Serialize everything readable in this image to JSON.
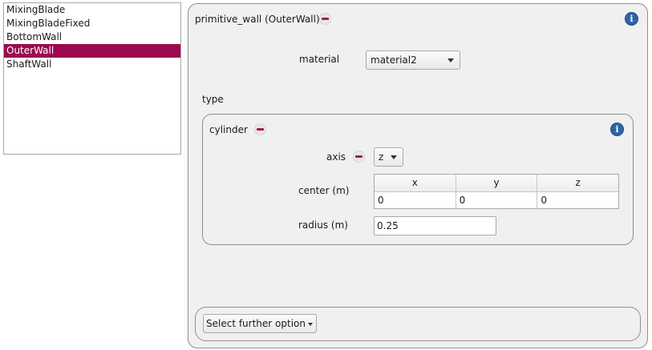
{
  "walls_list": {
    "items": [
      "MixingBlade",
      "MixingBladeFixed",
      "BottomWall",
      "OuterWall",
      "ShaftWall"
    ],
    "selected": "OuterWall"
  },
  "wall_panel": {
    "title": "primitive_wall (OuterWall)",
    "material_label": "material",
    "material_value": "material2",
    "type_label": "type"
  },
  "cylinder": {
    "title": "cylinder",
    "axis_label": "axis",
    "axis_value": "z",
    "center_label": "center (m)",
    "center_columns": [
      "x",
      "y",
      "z"
    ],
    "center_values": [
      "0",
      "0",
      "0"
    ],
    "radius_label": "radius (m)",
    "radius_value": "0.25"
  },
  "further": {
    "button_label": "Select further option"
  },
  "icons": {
    "info": "info-icon",
    "remove": "remove-icon",
    "dropdown": "chevron-down-icon"
  },
  "colors": {
    "selection": "#9b0a4f",
    "remove_icon": "#a3195b",
    "info_icon": "#2f63a8",
    "panel_background": "#f0f0f0"
  }
}
